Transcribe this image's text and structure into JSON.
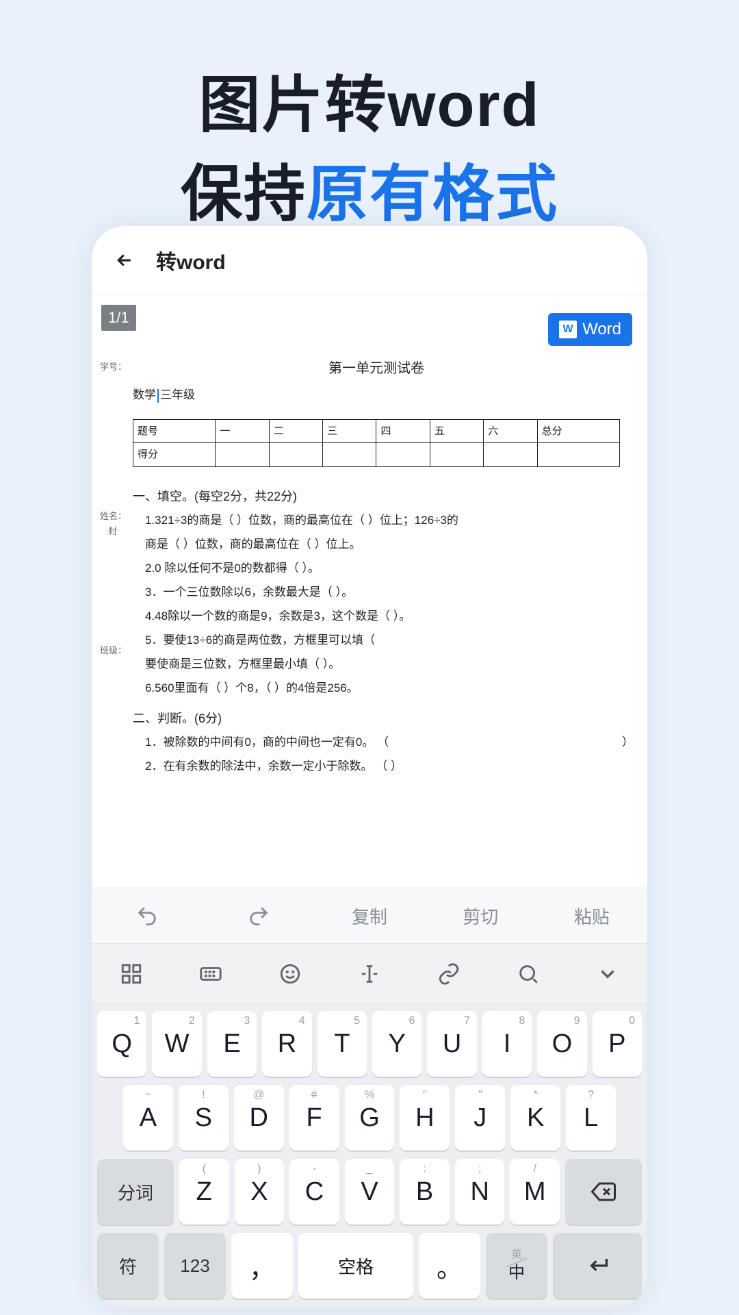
{
  "hero": {
    "line1": "图片转word",
    "line2_a": "保持",
    "line2_b": "原有格式"
  },
  "appbar": {
    "title": "转word"
  },
  "doc": {
    "page_indicator": "1/1",
    "word_button": "Word",
    "side_labels": {
      "xuehao": "学号：",
      "xingming": "姓名：",
      "feng": "封",
      "banji": "班级："
    },
    "subject_a": "数学",
    "subject_b": "三年级",
    "title": "第一单元测试卷",
    "table_headers": [
      "题号",
      "一",
      "二",
      "三",
      "四",
      "五",
      "六",
      "总分"
    ],
    "table_row2": "得分",
    "sec1": {
      "h": "一、填空。(每空2分，共22分)",
      "q1": "1.321÷3的商是（  ）位数，商的最高位在（  ）位上；126÷3的",
      "q1b": "商是（  ）位数，商的最高位在（  ）位上。",
      "q2": "2.0 除以任何不是0的数都得（  ）。",
      "q3": "3．一个三位数除以6，余数最大是（  ）。",
      "q4": "4.48除以一个数的商是9，余数是3，这个数是（  ）。",
      "q5": "5．要使13÷6的商是两位数，方框里可以填（",
      "q5b": "要使商是三位数，方框里最小填（  ）。",
      "q6": "6.560里面有（  ）个8，（  ）的4倍是256。"
    },
    "sec2": {
      "h": "二、判断。(6分)",
      "q1": "1．被除数的中间有0，商的中间也一定有0。   （",
      "q1r": "）",
      "q2": "2．在有余数的除法中，余数一定小于除数。   （  ）"
    }
  },
  "editbar": {
    "copy": "复制",
    "cut": "剪切",
    "paste": "粘贴"
  },
  "keyboard": {
    "row1": [
      {
        "n": "1",
        "m": "Q"
      },
      {
        "n": "2",
        "m": "W"
      },
      {
        "n": "3",
        "m": "E"
      },
      {
        "n": "4",
        "m": "R"
      },
      {
        "n": "5",
        "m": "T"
      },
      {
        "n": "6",
        "m": "Y"
      },
      {
        "n": "7",
        "m": "U"
      },
      {
        "n": "8",
        "m": "I"
      },
      {
        "n": "9",
        "m": "O"
      },
      {
        "n": "0",
        "m": "P"
      }
    ],
    "row2": [
      {
        "s": "~",
        "m": "A"
      },
      {
        "s": "!",
        "m": "S"
      },
      {
        "s": "@",
        "m": "D"
      },
      {
        "s": "#",
        "m": "F"
      },
      {
        "s": "%",
        "m": "G"
      },
      {
        "s": "\"",
        "m": "H"
      },
      {
        "s": "\"",
        "m": "J"
      },
      {
        "s": "*",
        "m": "K"
      },
      {
        "s": "?",
        "m": "L"
      }
    ],
    "row3": [
      {
        "s": "(",
        "m": "Z"
      },
      {
        "s": ")",
        "m": "X"
      },
      {
        "s": "-",
        "m": "C"
      },
      {
        "s": "_",
        "m": "V"
      },
      {
        "s": ":",
        "m": "B"
      },
      {
        "s": ";",
        "m": "N"
      },
      {
        "s": "/",
        "m": "M"
      }
    ],
    "fenci": "分词",
    "fu": "符",
    "n123": "123",
    "comma": "，",
    "space": "空格",
    "period": "。",
    "lang_top": "英",
    "lang_bot": "中"
  }
}
